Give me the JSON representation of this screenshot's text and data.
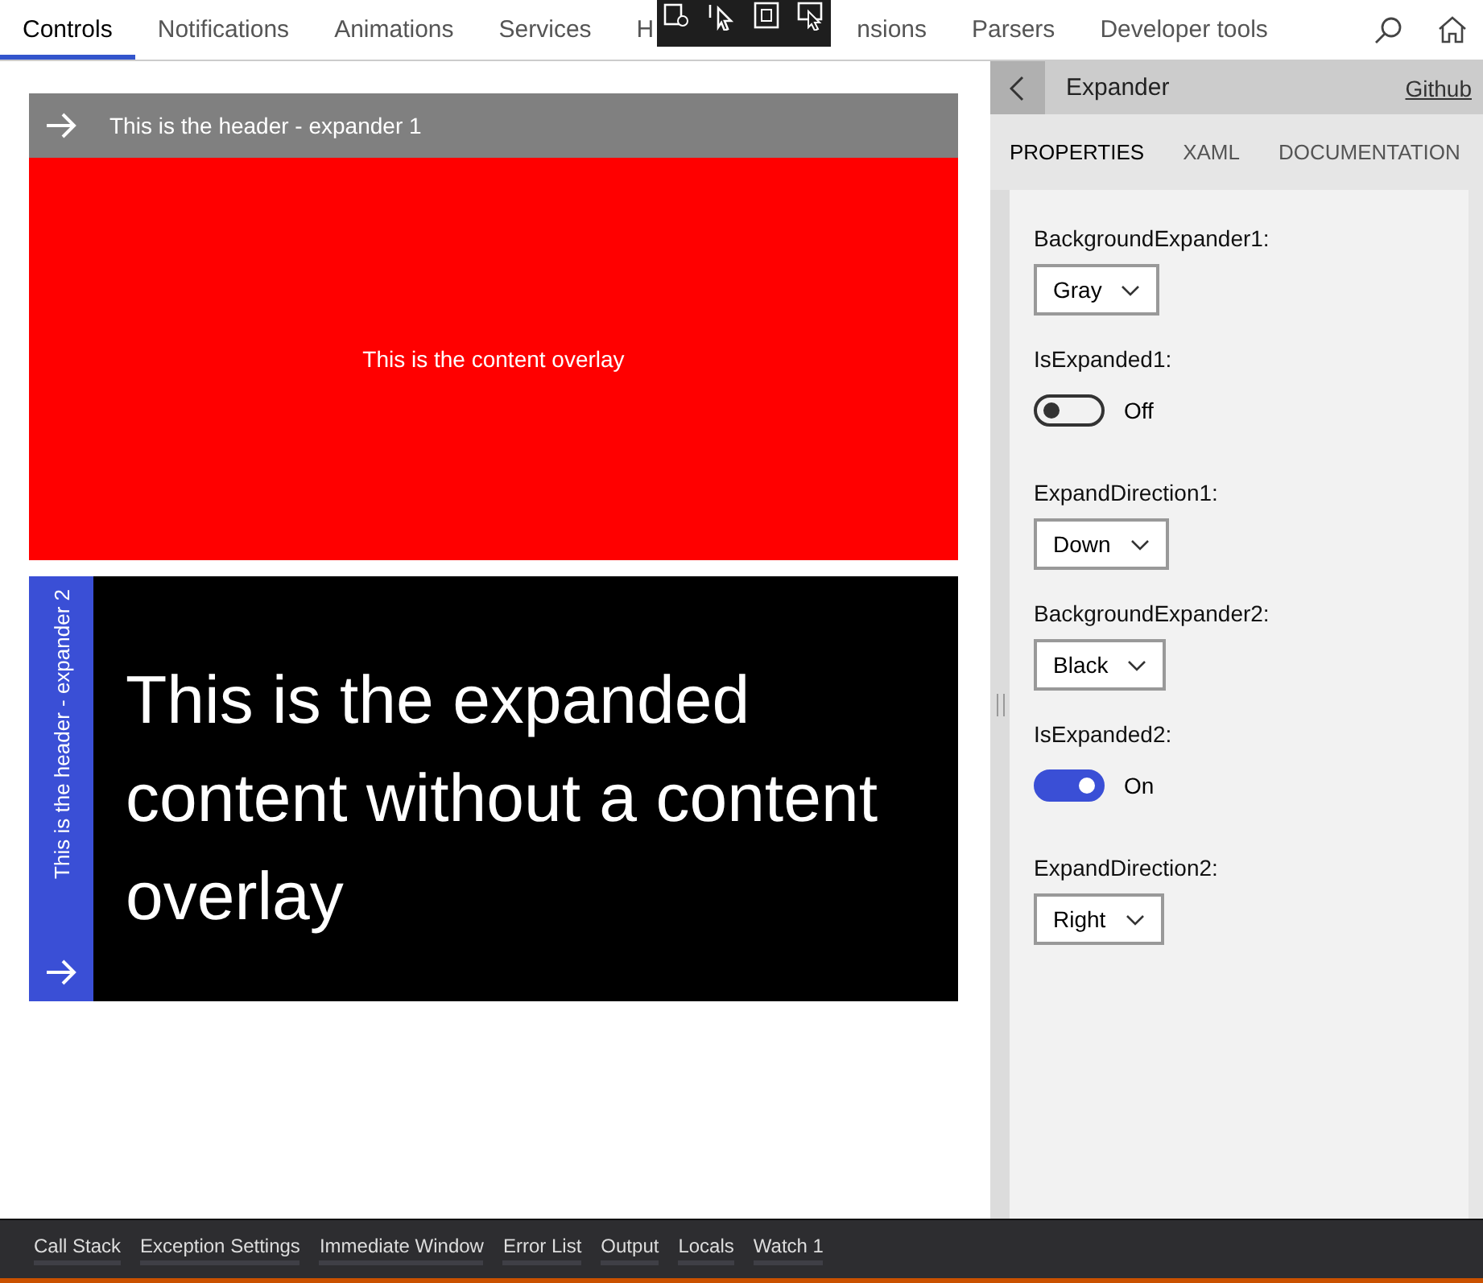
{
  "nav": {
    "tabs": [
      {
        "label": "Controls",
        "selected": true
      },
      {
        "label": "Notifications",
        "selected": false
      },
      {
        "label": "Animations",
        "selected": false
      },
      {
        "label": "Services",
        "selected": false
      },
      {
        "label": "H",
        "selected": false
      },
      {
        "label": "nsions",
        "selected": false
      },
      {
        "label": "Parsers",
        "selected": false
      },
      {
        "label": "Developer tools",
        "selected": false
      }
    ]
  },
  "expander1": {
    "header": "This is the header - expander 1",
    "content": "This is the content overlay"
  },
  "expander2": {
    "header": "This is the header - expander 2",
    "content": "This is the expanded content without a content overlay"
  },
  "panel": {
    "title": "Expander",
    "link": "Github",
    "tabs": [
      {
        "label": "PROPERTIES",
        "selected": true
      },
      {
        "label": "XAML",
        "selected": false
      },
      {
        "label": "DOCUMENTATION",
        "selected": false
      }
    ],
    "properties": [
      {
        "kind": "dropdown",
        "label": "BackgroundExpander1:",
        "value": "Gray"
      },
      {
        "kind": "toggle",
        "label": "IsExpanded1:",
        "on": false,
        "value": "Off"
      },
      {
        "kind": "dropdown",
        "label": "ExpandDirection1:",
        "value": "Down"
      },
      {
        "kind": "dropdown",
        "label": "BackgroundExpander2:",
        "value": "Black"
      },
      {
        "kind": "toggle",
        "label": "IsExpanded2:",
        "on": true,
        "value": "On"
      },
      {
        "kind": "dropdown",
        "label": "ExpandDirection2:",
        "value": "Right"
      }
    ]
  },
  "debug_tabs": [
    "Call Stack",
    "Exception Settings",
    "Immediate Window",
    "Error List",
    "Output",
    "Locals",
    "Watch 1"
  ]
}
